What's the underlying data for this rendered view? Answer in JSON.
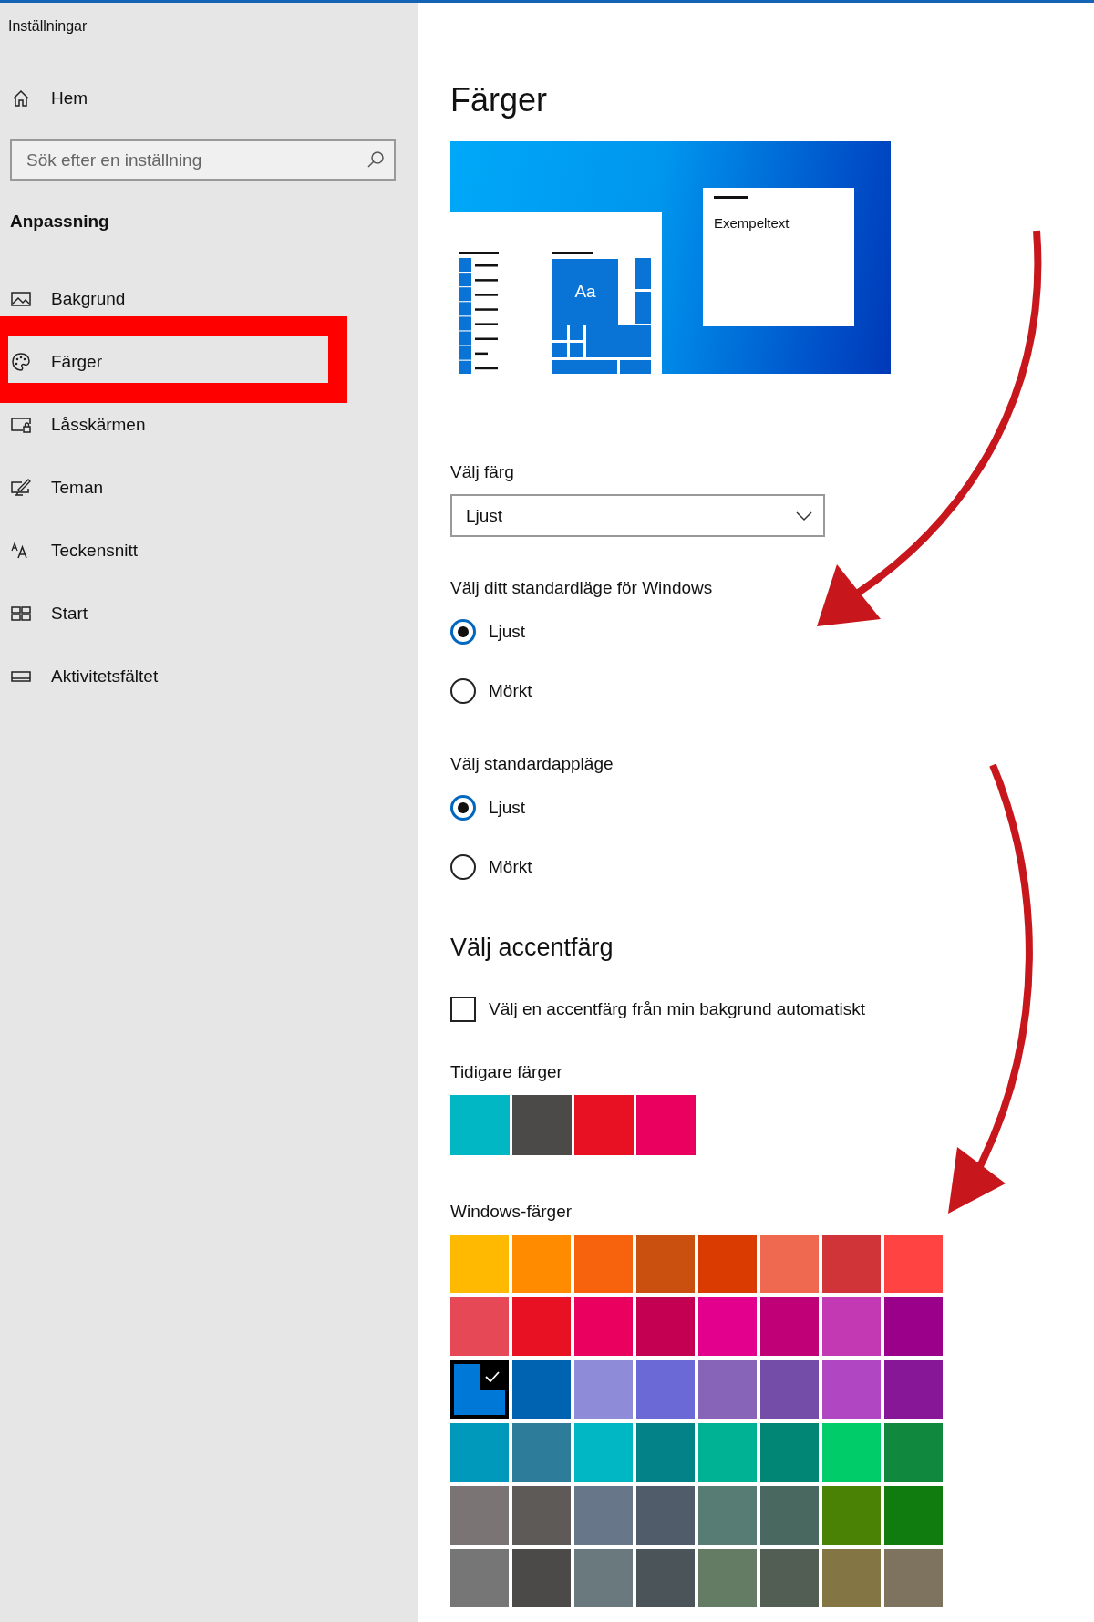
{
  "window": {
    "title": "Inställningar"
  },
  "sidebar": {
    "home": {
      "label": "Hem",
      "kind": "home"
    },
    "search": {
      "placeholder": "Sök efter en inställning"
    },
    "section": "Anpassning",
    "items": [
      {
        "label": "Bakgrund",
        "kind": "picture",
        "highlighted": false
      },
      {
        "label": "Färger",
        "kind": "palette",
        "highlighted": true
      },
      {
        "label": "Låsskärmen",
        "kind": "lockscreen",
        "highlighted": false
      },
      {
        "label": "Teman",
        "kind": "themes",
        "highlighted": false
      },
      {
        "label": "Teckensnitt",
        "kind": "fonts",
        "highlighted": false
      },
      {
        "label": "Start",
        "kind": "start",
        "highlighted": false
      },
      {
        "label": "Aktivitetsfältet",
        "kind": "taskbar",
        "highlighted": false
      }
    ]
  },
  "page": {
    "title": "Färger",
    "preview": {
      "sample_text": "Exempeltext",
      "tile_text": "Aa"
    },
    "color_mode": {
      "label": "Välj färg",
      "value": "Ljust"
    },
    "windows_mode": {
      "label": "Välj ditt standardläge för Windows",
      "options": [
        {
          "label": "Ljust",
          "selected": true
        },
        {
          "label": "Mörkt",
          "selected": false
        }
      ]
    },
    "app_mode": {
      "label": "Välj standardappläge",
      "options": [
        {
          "label": "Ljust",
          "selected": true
        },
        {
          "label": "Mörkt",
          "selected": false
        }
      ]
    },
    "accent": {
      "title": "Välj accentfärg",
      "auto": {
        "label": "Välj en accentfärg från min bakgrund automatiskt",
        "checked": false
      },
      "recent": {
        "label": "Tidigare färger",
        "colors": [
          {
            "color": "#00b7c3",
            "selected": false
          },
          {
            "color": "#4c4a48",
            "selected": false
          },
          {
            "color": "#e81123",
            "selected": false
          },
          {
            "color": "#ea005e",
            "selected": false
          }
        ]
      },
      "windows_colors": {
        "label": "Windows-färger",
        "colors": [
          {
            "color": "#ffb900",
            "selected": false
          },
          {
            "color": "#ff8c00",
            "selected": false
          },
          {
            "color": "#f7630c",
            "selected": false
          },
          {
            "color": "#ca5010",
            "selected": false
          },
          {
            "color": "#da3b01",
            "selected": false
          },
          {
            "color": "#ef6950",
            "selected": false
          },
          {
            "color": "#d13438",
            "selected": false
          },
          {
            "color": "#ff4343",
            "selected": false
          },
          {
            "color": "#e74856",
            "selected": false
          },
          {
            "color": "#e81123",
            "selected": false
          },
          {
            "color": "#ea005e",
            "selected": false
          },
          {
            "color": "#c30052",
            "selected": false
          },
          {
            "color": "#e3008c",
            "selected": false
          },
          {
            "color": "#bf0077",
            "selected": false
          },
          {
            "color": "#c239b3",
            "selected": false
          },
          {
            "color": "#9a0089",
            "selected": false
          },
          {
            "color": "#0078d7",
            "selected": true
          },
          {
            "color": "#0063b1",
            "selected": false
          },
          {
            "color": "#8e8cd8",
            "selected": false
          },
          {
            "color": "#6b69d6",
            "selected": false
          },
          {
            "color": "#8764b8",
            "selected": false
          },
          {
            "color": "#744da9",
            "selected": false
          },
          {
            "color": "#b146c2",
            "selected": false
          },
          {
            "color": "#881798",
            "selected": false
          },
          {
            "color": "#0099bc",
            "selected": false
          },
          {
            "color": "#2d7d9a",
            "selected": false
          },
          {
            "color": "#00b7c3",
            "selected": false
          },
          {
            "color": "#038387",
            "selected": false
          },
          {
            "color": "#00b294",
            "selected": false
          },
          {
            "color": "#018574",
            "selected": false
          },
          {
            "color": "#00cc6a",
            "selected": false
          },
          {
            "color": "#10893e",
            "selected": false
          },
          {
            "color": "#7a7574",
            "selected": false
          },
          {
            "color": "#5d5a58",
            "selected": false
          },
          {
            "color": "#68768a",
            "selected": false
          },
          {
            "color": "#515c6b",
            "selected": false
          },
          {
            "color": "#567c73",
            "selected": false
          },
          {
            "color": "#486860",
            "selected": false
          },
          {
            "color": "#498205",
            "selected": false
          },
          {
            "color": "#107c10",
            "selected": false
          },
          {
            "color": "#767676",
            "selected": false
          },
          {
            "color": "#4c4a48",
            "selected": false
          },
          {
            "color": "#69797e",
            "selected": false
          },
          {
            "color": "#4a5459",
            "selected": false
          },
          {
            "color": "#647c64",
            "selected": false
          },
          {
            "color": "#525e54",
            "selected": false
          },
          {
            "color": "#847545",
            "selected": false
          },
          {
            "color": "#7e735f",
            "selected": false
          }
        ]
      }
    }
  }
}
